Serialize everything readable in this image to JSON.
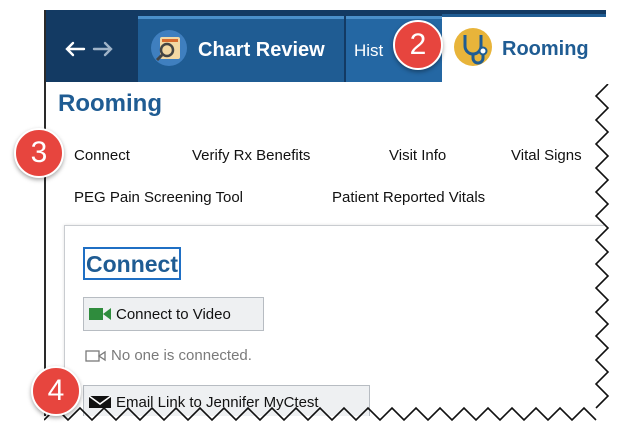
{
  "tabs": {
    "chart_review": "Chart Review",
    "history": "Hist",
    "rooming": "Rooming"
  },
  "page": {
    "title": "Rooming"
  },
  "subnav": {
    "row1": [
      "Connect",
      "Verify Rx Benefits",
      "Visit Info",
      "Vital Signs"
    ],
    "row2": [
      "PEG Pain Screening Tool",
      "Patient Reported Vitals"
    ]
  },
  "panel": {
    "heading": "Connect",
    "video_button": "Connect to Video",
    "status": "No one is connected.",
    "email_button": "Email Link to Jennifer MyCtest"
  },
  "steps": [
    "2",
    "3",
    "4"
  ],
  "colors": {
    "tabbar": "#133a63",
    "tab": "#1f5c93",
    "accent": "#1f5c93",
    "step_badge": "#e7453e"
  }
}
